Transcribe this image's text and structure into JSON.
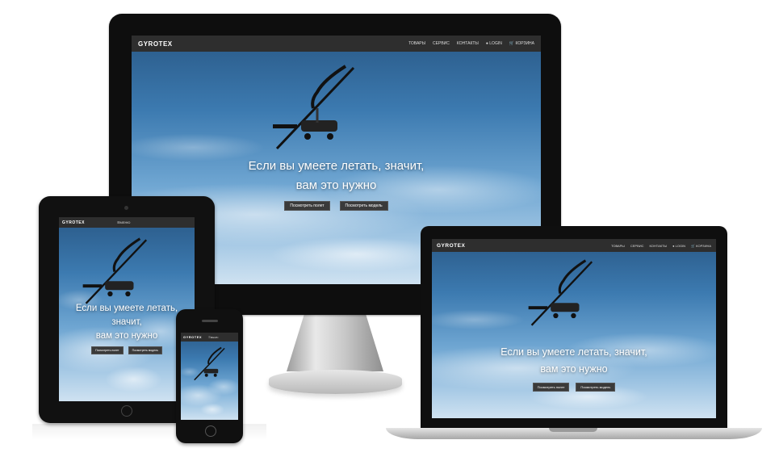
{
  "site": {
    "logo": "GYROTEX",
    "nav": [
      "ТОВАРЫ",
      "СЕРВИС",
      "КОНТАКТЫ",
      "LOGIN",
      "КОРЗИНА"
    ],
    "menu_label": "МЕНЮ",
    "hero_line1": "Если вы умеете летать, значит,",
    "hero_line2": "вам это нужно",
    "tablet_line1": "Если вы умеете летать,",
    "tablet_line2": "значит,",
    "tablet_line3": "вам это нужно",
    "btn_video": "Посмотреть полет",
    "btn_model": "Посмотреть модель"
  },
  "colors": {
    "navbar": "#2e2e2e",
    "sky_top": "#2a5a88",
    "sky_bottom": "#cfe2f1",
    "button": "#3a3a3a"
  },
  "icons": {
    "login": "user-icon",
    "cart": "cart-icon",
    "product": "gyroplane-image"
  }
}
